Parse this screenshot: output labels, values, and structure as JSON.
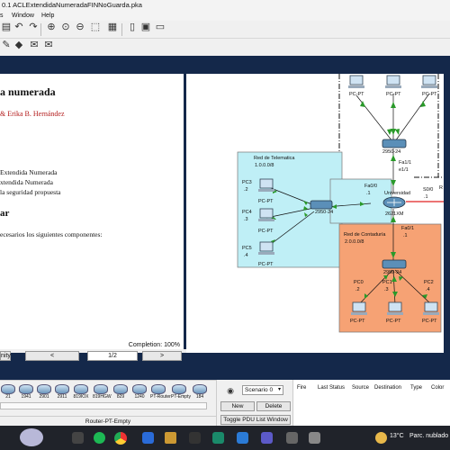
{
  "window": {
    "title": "0.1 ACLExtendidaNumeradaFINNoGuarda.pka"
  },
  "menu": {
    "items": [
      "s",
      "Window",
      "Help"
    ]
  },
  "document": {
    "title": "a numerada",
    "authors": "& Erika B. Hernández",
    "lines": [
      "Extendida Numerada",
      "xtendida Numerada",
      "la seguridad propuesta"
    ],
    "section": "ar",
    "body": "ecesarios los siguientes componentes:"
  },
  "instructions": {
    "completion": "Completion: 100%",
    "prev_label": "<",
    "page": "1/2",
    "next_label": ">",
    "left_btn": "nity"
  },
  "topology": {
    "pcs_top": [
      "PC-PT",
      "PC-PT",
      "PC-PT"
    ],
    "switch_top": "2950-24",
    "router_iface_top": "Fa1/1",
    "router_iface_top_ip": "e1/1",
    "net_telematica": [
      "Red de Telematica",
      "1.0.0.0/8"
    ],
    "net_telematica_pcs": [
      {
        "name": "PC3",
        "ip": ".2",
        "type": "PC-PT"
      },
      {
        "name": "PC4",
        "ip": ".3",
        "type": "PC-PT"
      },
      {
        "name": "PC5",
        "ip": ".4",
        "type": "PC-PT"
      }
    ],
    "switch_left": "2950-24",
    "router": {
      "name": "Universidad",
      "model": "2621XM",
      "fa0_0": "Fa0/0",
      "fa0_0_ip": ".1",
      "s0_0": "S0/0",
      "s0_0_ip": ".1",
      "fa0_1": "Fa0/1",
      "fa0_1_ip": ".1",
      "r_label": "R"
    },
    "net_contaduria": [
      "Red de Contaduría",
      "2.0.0.0/8"
    ],
    "switch_bottom": "2950-24",
    "net_contaduria_pcs": [
      {
        "name": "PC0",
        "ip": ".2",
        "type": "PC-PT"
      },
      {
        "name": "PC1",
        "ip": ".3",
        "type": "PC-PT"
      },
      {
        "name": "PC2",
        "ip": ".4",
        "type": "PC-PT"
      }
    ]
  },
  "devices": {
    "models": [
      "21",
      "1941",
      "2901",
      "2911",
      "819IOX",
      "819HGW",
      "829",
      "1240",
      "PT-Router",
      "PT-Empty",
      "184"
    ],
    "selected_label": "Router-PT-Empty"
  },
  "pdu": {
    "scenario": "Scenario 0",
    "new_label": "New",
    "delete_label": "Delete",
    "toggle_label": "Toggle PDU List Window",
    "columns": [
      "Fire",
      "Last Status",
      "Source",
      "Destination",
      "Type",
      "Color"
    ]
  },
  "taskbar": {
    "weather": "13°C",
    "weather_text": "Parc. nublado"
  },
  "colors": {
    "dark_band": "#14284a",
    "telematica_bg": "#bfeff6",
    "contaduria_bg": "#f6a274",
    "link_green": "#2a9a2a",
    "serial_red": "#e02020"
  }
}
